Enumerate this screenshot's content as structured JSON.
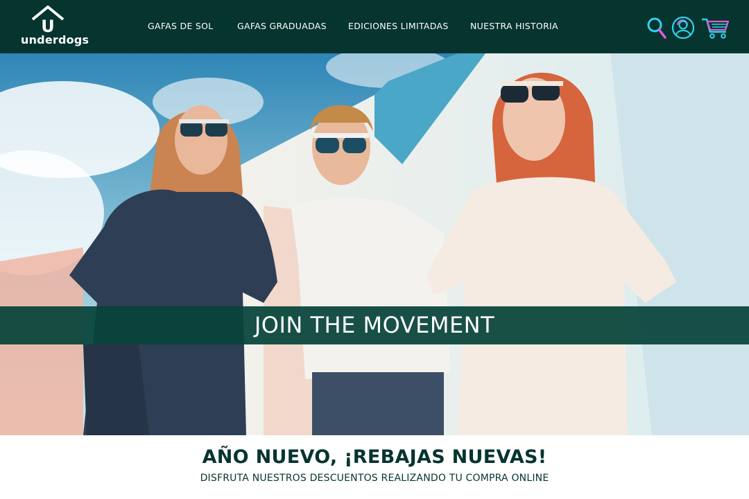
{
  "brand": {
    "name": "underdogs",
    "logo_letter": "U"
  },
  "nav": {
    "items": [
      {
        "label": "GAFAS DE SOL"
      },
      {
        "label": "GAFAS GRADUADAS"
      },
      {
        "label": "EDICIONES LIMITADAS"
      },
      {
        "label": "NUESTRA HISTORIA"
      }
    ]
  },
  "header_icons": [
    "search-icon",
    "user-icon",
    "cart-icon"
  ],
  "hero": {
    "banner_text": "JOIN THE MOVEMENT"
  },
  "promo": {
    "title": "AÑO NUEVO, ¡REBAJAS NUEVAS!",
    "subtitle": "DISFRUTA NUESTROS DESCUENTOS REALIZANDO TU COMPRA ONLINE"
  },
  "colors": {
    "header_bg": "#06342f",
    "banner_bg": "#06443a",
    "text_dark": "#06342f",
    "icon_cyan": "#2fd6f0",
    "icon_magenta": "#e25ad8"
  }
}
